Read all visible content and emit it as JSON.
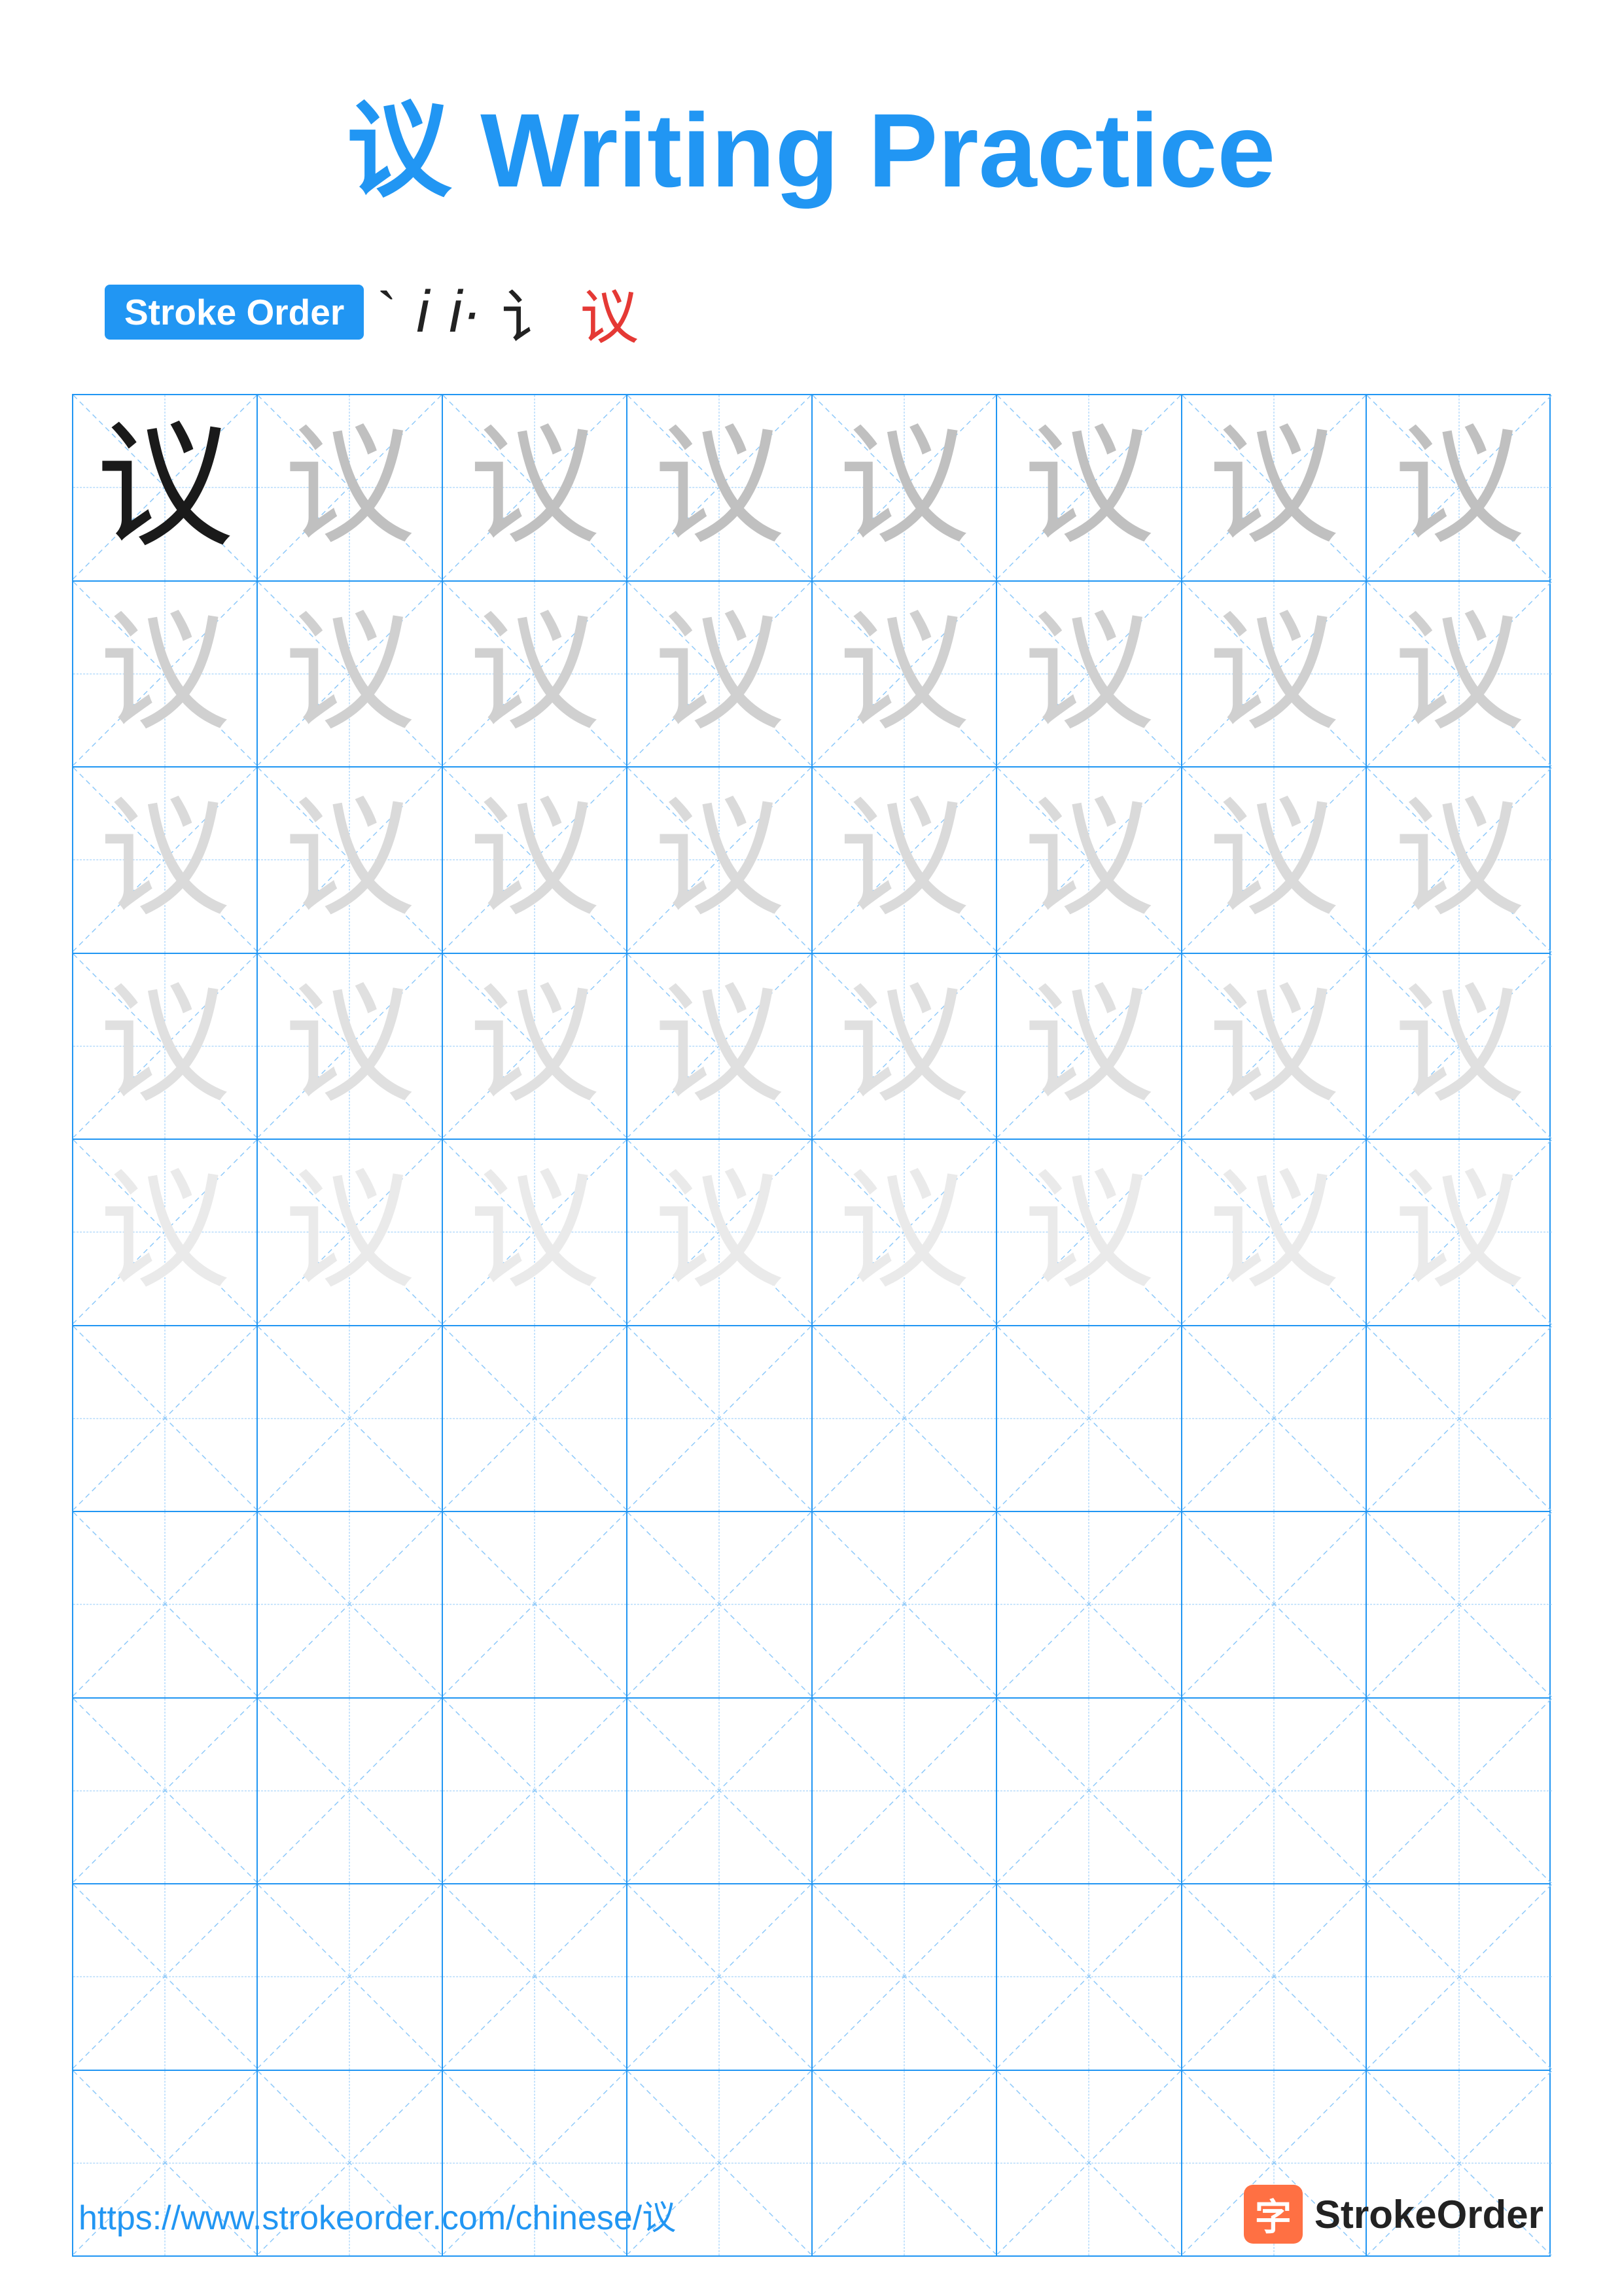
{
  "title": {
    "chinese": "议",
    "english": "Writing Practice"
  },
  "stroke_order": {
    "badge_label": "Stroke Order",
    "sequence": [
      "`",
      "i",
      "i·",
      "讠",
      "议"
    ]
  },
  "grid": {
    "rows": 10,
    "cols": 8,
    "practice_char": "议",
    "filled_rows": 5,
    "char_opacities": [
      "dark",
      "light1",
      "light2",
      "light3",
      "light4"
    ]
  },
  "footer": {
    "url": "https://www.strokeorder.com/chinese/议",
    "brand_icon": "字",
    "brand_name": "StrokeOrder"
  }
}
